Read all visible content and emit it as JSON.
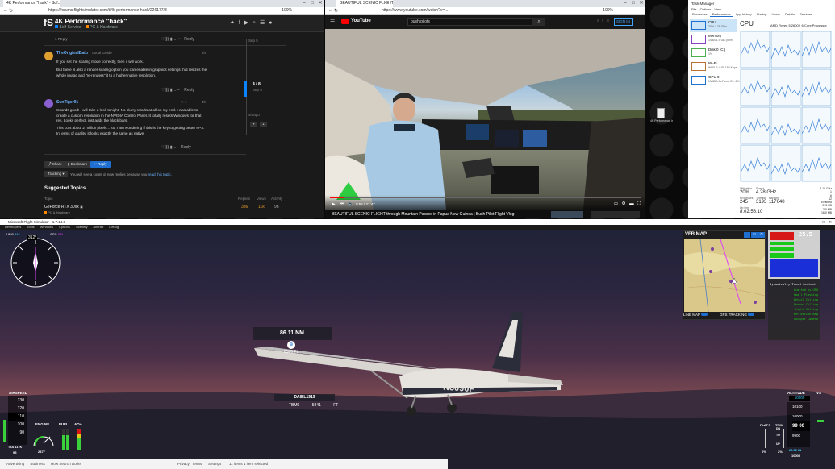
{
  "forum": {
    "tab_title": "4K Performance \"hack\" - Sof...",
    "url": "https://forums.flightsimulator.com/t/4k-performance-hack/226177/8",
    "zoom": "100%",
    "title": "4K Performance \"hack\"",
    "category": "Self-Service",
    "subcategory": "PC & Hardware",
    "reply_label": "Reply",
    "posts": [
      {
        "user": "TheOriginalBatu",
        "role": "Local Guide",
        "age": "4h",
        "text1": "If you set the scaling mode correctly, then it will work.",
        "text2": "But there is also a render scaling option you can enable in graphics settings that resizes the whole image and \"re-renders\" it to a higher native resolution."
      },
      {
        "user": "SunTiger91",
        "age": "4h",
        "text1": "Sounds good! I will take a look tonight! No blurry results at all on my end. I was able to create a custom resolution in the NVIDIA Control Panel. It totally resets Windows for that res. Looks perfect, just adds the black bars.",
        "text2": "This cuts about 2 million pixels... so, I am wondering if this is the key to getting better FPS. In terms of quality, it looks exactly the same as native."
      }
    ],
    "one_reply": "1 Reply",
    "timeline_date": "Sep 5",
    "timeline_pos": "4 / 8",
    "timeline_end": "Sep 5",
    "timeline_ago": "4h ago",
    "share": "Share",
    "bookmark": "Bookmark",
    "reply_btn": "Reply",
    "tracking": "Tracking",
    "tracking_note": "You will see a count of new replies because you",
    "tracking_link": "read this topic.",
    "suggested": "Suggested Topics",
    "col_topic": "Topic",
    "col_replies": "Replies",
    "col_views": "Views",
    "col_activity": "Activity",
    "sug_title": "GeForce RTX 30xx",
    "sug_cat": "PC & Hardware",
    "sug_replies": "336",
    "sug_views": "11k",
    "sug_activity": "9h"
  },
  "youtube": {
    "tab_title": "BEAUTIFUL SCENIC FLIGHT th...",
    "url": "https://www.youtube.com/watch?v=...",
    "zoom": "100%",
    "logo": "YouTube",
    "search": "bush pilots",
    "signin": "SIGN IN",
    "time": "0:56 / 21:47",
    "video_title": "BEAUTIFUL SCENIC FLIGHT through Mountain Passes in Papua New Guinea | Bush Pilot Flight Vlog"
  },
  "taskmgr": {
    "title": "Task Manager",
    "menu": [
      "File",
      "Options",
      "View"
    ],
    "tabs": [
      "Processes",
      "Performance",
      "App history",
      "Startup",
      "Users",
      "Details",
      "Services"
    ],
    "items": [
      {
        "name": "CPU",
        "sub": "20% 4.28 GHz"
      },
      {
        "name": "Memory",
        "sub": "14.6/31.9 GB (46%)"
      },
      {
        "name": "Disk 0 (C:)",
        "sub": "1%"
      },
      {
        "name": "Wi-Fi",
        "sub": "Wi-Fi S: 0  R: 184 Kbps"
      },
      {
        "name": "GPU 0",
        "sub": "NVIDIA GeForce G... 8%"
      }
    ],
    "cpu_title": "CPU",
    "cpu_model": "AMD Ryzen 5 2600X 6-Core Processor",
    "stats": {
      "util": "20%",
      "speed": "4.28 GHz",
      "procs": "245",
      "threads": "3193",
      "handles": "117040",
      "uptime": "8:02:56:10"
    },
    "right_stats": [
      "4.10 GHz",
      "1",
      "6",
      "12",
      "Enabled",
      "576 KB",
      "3.0 MB",
      "16.0 MB"
    ]
  },
  "sim": {
    "title": "Microsoft Flight Simulator - 1.7.14.0",
    "menu": "Developers Tools Windows Options Scenery Aircraft Debug",
    "distance": "86.11 NM",
    "alt_marker": "6500 Ft",
    "callsign": "DAIEL1919",
    "waypoint": "TBM9",
    "waypoint_alt": "5841 FT",
    "tail": "N3090F",
    "vfr_title": "VFR MAP",
    "line_map": "LINE MAP",
    "gps_tracking": "GPS TRACKING",
    "heading": "312°",
    "hdg_label": "HDG",
    "hdg_val": "312",
    "crs_label": "CRS",
    "crs_val": "359",
    "airspeed_label": "AIRSPEED",
    "airspeed_values": [
      "130",
      "120",
      "110",
      "100",
      "90"
    ],
    "airspeed_current": "110",
    "tas_label": "TAS 117KT",
    "tas_val": "98",
    "engine_label": "ENGINE",
    "rpm": "2477",
    "fuel_label": "FUEL",
    "aoa_label": "AOA",
    "altitude_label": "ALTITUDE",
    "altitude_sel": "10000",
    "altitude_values": [
      "10100",
      "10000",
      "9900",
      "9800"
    ],
    "altitude_current": "99 00",
    "baro": "29.92 IN",
    "alt_bottom": "10000",
    "vs_label": "VS",
    "flaps_label": "FLAPS",
    "trim_label": "TRIM",
    "to_label": "TO",
    "up_label": "UP",
    "dn_label": "DN",
    "flaps_pct": "0%",
    "trim_pct": "2%",
    "debug_title": "Dynamically-Tuned Content",
    "debug_fps": "25.5",
    "debug_lines": [
      "Limited by GPU",
      "Small Flashing",
      "Detail Culling",
      "Shadow Culling",
      "Light Culling",
      "Reflection map",
      "Cockpit Camera"
    ],
    "taskbar": [
      "Advertising",
      "Business",
      "How Search works",
      "Privacy",
      "Terms",
      "Settings"
    ],
    "status": "11 items   1 item selected"
  },
  "desktop": {
    "file_label": "4K Performance hack"
  },
  "colors": {
    "accent": "#1f6fd1",
    "vfr_land": "#d9c88a",
    "debug_green": "#19c919",
    "debug_blue": "#1b2fd9",
    "hud_green": "#3ad13a"
  }
}
